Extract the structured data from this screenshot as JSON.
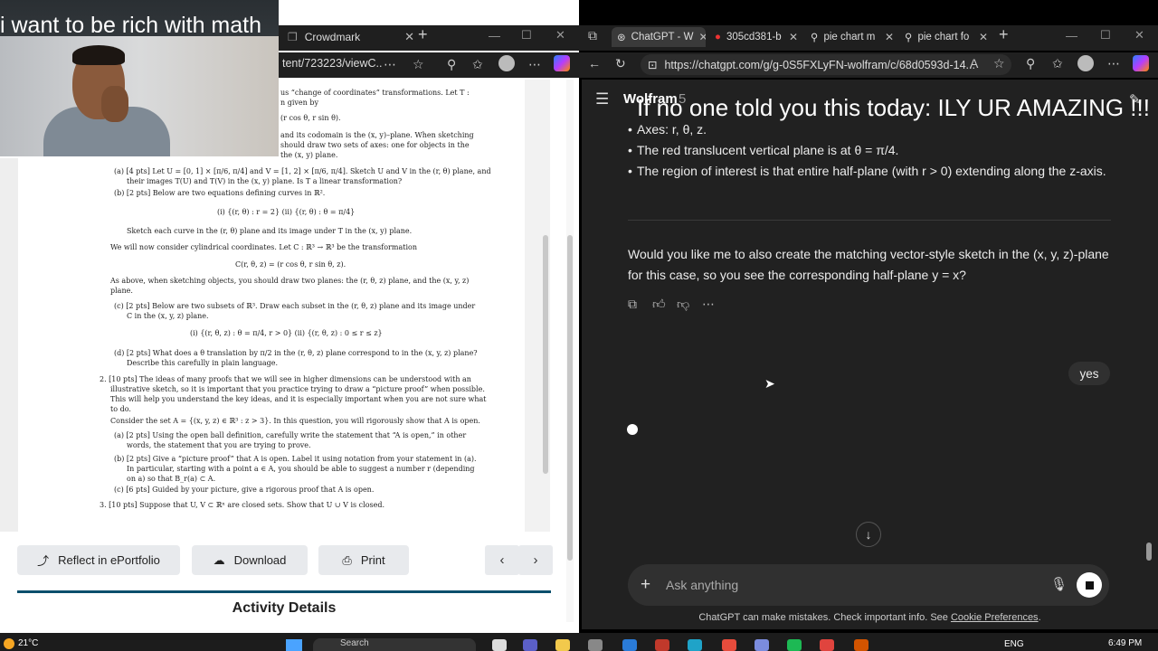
{
  "overlay": {
    "left_caption": "i want to be rich with math",
    "right_caption": "If no one told you this today: ILY UR AMAZING !!!"
  },
  "left_browser": {
    "tab_title": "Crowdmark",
    "url": "tent/723223/viewC...",
    "new_tab": "+",
    "pdf": {
      "lines": [
        "us “change of coordinates” transformations.  Let T :",
        "n given by",
        "(r cos θ, r sin θ).",
        "and its codomain is the (x, y)–plane.  When sketching",
        "should draw two sets of axes:  one for objects in the",
        "the (x, y) plane.",
        "(a)  [4 pts]  Let U = [0, 1] × [π/6, π/4] and V = [1, 2] × [π/6, π/4].  Sketch U and V in the (r, θ) plane, and",
        "their images T(U) and T(V) in the (x, y) plane.  Is T a linear transformation?",
        "(b)  [2 pts]  Below are two equations defining curves in ℝ².",
        "(i)  {(r, θ) : r = 2}              (ii)  {(r, θ) : θ = π/4}",
        "Sketch each curve in the (r, θ) plane and its image under T in the (x, y) plane.",
        "We will now consider cylindrical coordinates.  Let C : ℝ³ → ℝ³ be the transformation",
        "C(r, θ, z) = (r cos θ, r sin θ, z).",
        "As above, when sketching objects, you should draw two planes: the (r, θ, z) plane, and the (x, y, z)",
        "plane.",
        "(c)  [2 pts]  Below are two subsets of ℝ³.  Draw each subset in the (r, θ, z) plane and its image under",
        "C in the (x, y, z) plane.",
        "(i)  {(r, θ, z) : θ = π/4, r > 0}              (ii)  {(r, θ, z) : 0 ≤ r ≤ z}",
        "(d)  [2 pts]  What does a θ translation by π/2 in the (r, θ, z) plane correspond to in the (x, y, z) plane?",
        "Describe this carefully in plain language.",
        "2.  [10 pts]  The ideas of many proofs that we will see in higher dimensions can be understood with an",
        "illustrative sketch, so it is important that you practice trying to draw a “picture proof” when possible.",
        "This will help you understand the key ideas, and it is especially important when you are not sure what",
        "to do.",
        "Consider the set A = {(x, y, z) ∈ ℝ³ : z > 3}.  In this question, you will rigorously show that A is open.",
        "(a)  [2 pts]  Using the open ball definition, carefully write the statement that “A is open,” in other",
        "words, the statement that you are trying to prove.",
        "(b)  [2 pts]  Give a “picture proof” that A is open.  Label it using notation from your statement in (a).",
        "In particular, starting with a point a ∈ A, you should be able to suggest a number r (depending",
        "on a) so that B_r(a) ⊂ A.",
        "(c)  [6 pts]  Guided by your picture, give a rigorous proof that A is open.",
        "3.  [10 pts]  Suppose that U, V ⊂ ℝⁿ are closed sets.  Show that U ∪ V is closed."
      ]
    },
    "actions": {
      "reflect": "Reflect in ePortfolio",
      "download": "Download",
      "print": "Print"
    },
    "activity_title": "Activity Details"
  },
  "right_browser": {
    "tabs": [
      {
        "label": "ChatGPT - W"
      },
      {
        "label": "305cd381-b"
      },
      {
        "label": "pie chart m"
      },
      {
        "label": "pie chart fo"
      }
    ],
    "url": "https://chatgpt.com/g/g-0S5FXLyFN-wolfram/c/68d0593d-14...",
    "chat": {
      "model_name": "Wolfram",
      "model_version": "5",
      "bullets": [
        "Axes: r, θ, z.",
        "The red translucent vertical plane is at θ = π/4.",
        "The region of interest is that entire half-plane (with r > 0) extending along the z-axis."
      ],
      "question": "Would you like me to also create the matching vector-style sketch in the (x, y, z)-plane for this case, so you see the corresponding half-plane y = x?",
      "user_message": "yes",
      "input_placeholder": "Ask anything",
      "disclaimer": "ChatGPT can make mistakes. Check important info. See",
      "disclaimer_link": "Cookie Preferences"
    }
  },
  "taskbar": {
    "weather": "21°C",
    "search": "Search",
    "language": "ENG",
    "time": "6:49 PM"
  }
}
